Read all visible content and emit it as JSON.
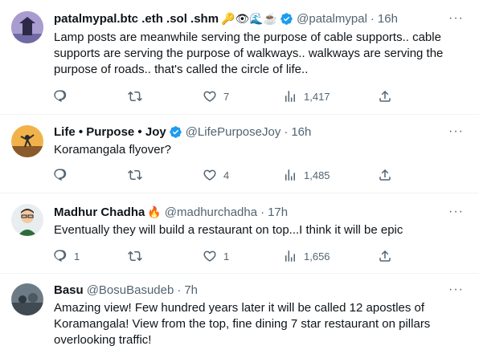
{
  "tweets": [
    {
      "name": "patalmypal.btc .eth .sol .shm",
      "emojis": "🔑👁🌊☕",
      "handle": "@patalmypal",
      "time": "16h",
      "text": "Lamp posts are meanwhile serving the purpose of cable supports.. cable supports are serving the purpose of walkways.. walkways are serving the purpose of roads.. that's called the circle of life..",
      "replies": "",
      "retweets": "",
      "likes": "7",
      "views": "1,417"
    },
    {
      "name": "Life • Purpose • Joy",
      "emojis": "",
      "handle": "@LifePurposeJoy",
      "time": "16h",
      "text": "Koramangala flyover?",
      "replies": "",
      "retweets": "",
      "likes": "4",
      "views": "1,485"
    },
    {
      "name": "Madhur Chadha",
      "emojis": "🔥",
      "handle": "@madhurchadha",
      "time": "17h",
      "text": "Eventually they will build a restaurant on top...I think it will be epic",
      "replies": "1",
      "retweets": "",
      "likes": "1",
      "views": "1,656"
    },
    {
      "name": "Basu",
      "emojis": "",
      "handle": "@BosuBasudeb",
      "time": "7h",
      "text": "Amazing view! Few hundred years later it will be called 12 apostles of Koramangala! View from the top, fine dining 7 star restaurant on pillars overlooking traffic!"
    }
  ],
  "colors": {
    "accent": "#1d9bf0",
    "muted": "#536471",
    "text": "#0f1419"
  }
}
